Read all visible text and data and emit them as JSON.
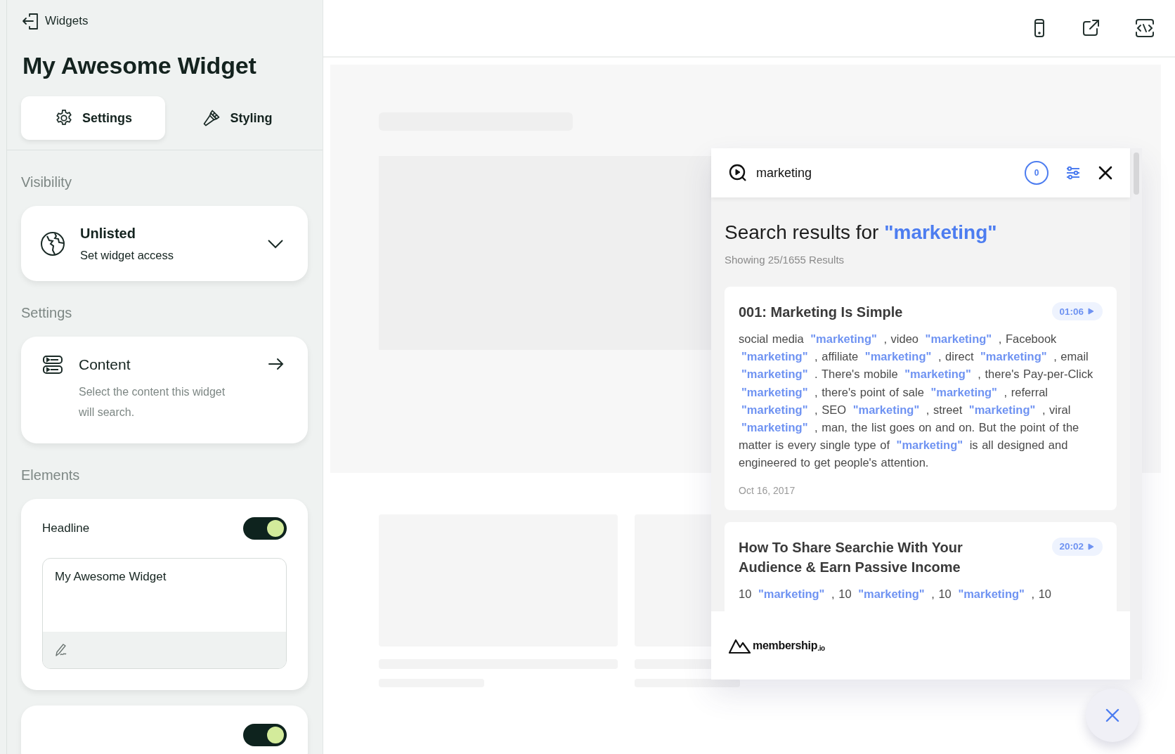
{
  "back_link": {
    "label": "Widgets"
  },
  "title": "My Awesome Widget",
  "tabs": [
    {
      "label": "Settings",
      "kind": "gear",
      "selected": true
    },
    {
      "label": "Styling",
      "kind": "brush",
      "selected": false
    }
  ],
  "visibility": {
    "heading": "Visibility",
    "title": "Unlisted",
    "subtitle": "Set widget access"
  },
  "settings": {
    "heading": "Settings",
    "items": [
      {
        "title": "Content",
        "description": "Select the content this widget will search."
      }
    ]
  },
  "elements": {
    "heading": "Elements",
    "items": [
      {
        "label": "Headline",
        "on": true,
        "value": "My Awesome Widget"
      },
      {
        "on": true
      }
    ]
  },
  "toolbar": [
    {
      "kind": "mobile"
    },
    {
      "kind": "external"
    },
    {
      "kind": "embed"
    }
  ],
  "search": {
    "query": "marketing",
    "count": "0",
    "heading": "Search results for **\"marketing\"**",
    "summary": "Showing 25/1655 Results",
    "results": [
      {
        "title": "001: Marketing Is Simple",
        "duration": "01:06",
        "snippet": "social media **\"marketing\"** , video **\"marketing\"** , Facebook **\"marketing\"** , affiliate **\"marketing\"** , direct **\"marketing\"** , email **\"marketing\"** . There's mobile **\"marketing\"** , there's Pay-per-Click **\"marketing\"** , there's point of sale **\"marketing\"** , referral **\"marketing\"** , SEO **\"marketing\"** , street **\"marketing\"** , viral **\"marketing\"** , man, the list goes on and on. But the point of the matter is every single type of **\"marketing\"** is all designed and engineered to get people's attention.",
        "date": "Oct 16, 2017"
      },
      {
        "title": "How To Share Searchie With Your Audience & Earn Passive Income",
        "duration": "20:02",
        "snippet": "10 **\"marketing\"** , 10 **\"marketing\"** , 10 **\"marketing\"** , 10"
      }
    ],
    "brand": "membership$_{.io}$"
  }
}
